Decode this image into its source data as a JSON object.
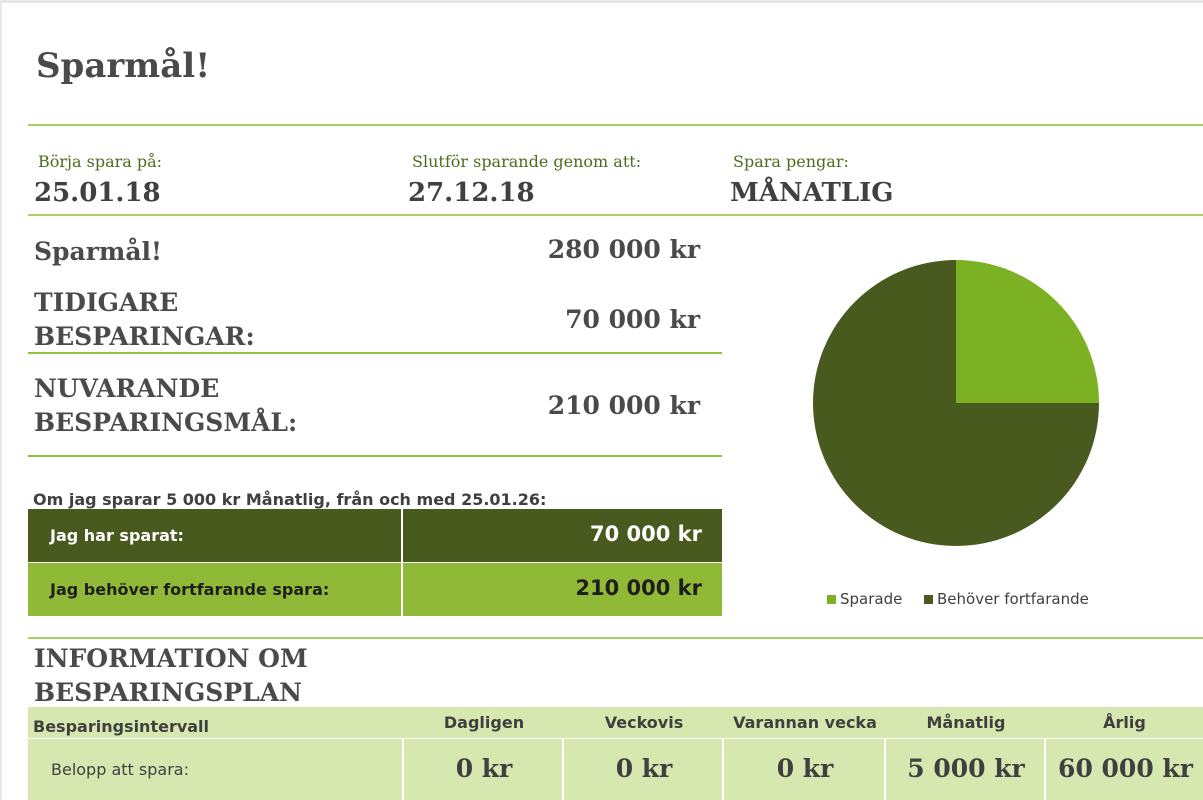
{
  "title": "Sparmål!",
  "start": {
    "label": "Börja spara på:",
    "value": "25.01.18"
  },
  "end": {
    "label": "Slutför sparande genom att:",
    "value": "27.12.18"
  },
  "frequency": {
    "label": "Spara pengar:",
    "value": "MÅNATLIG"
  },
  "goal": {
    "label": "Sparmål!",
    "value": "280 000 kr"
  },
  "previous": {
    "label_line1": "TIDIGARE",
    "label_line2": "BESPARINGAR:",
    "value": "70 000 kr"
  },
  "current_goal": {
    "label_line1": "NUVARANDE",
    "label_line2": "BESPARINGSMÅL:",
    "value": "210 000 kr"
  },
  "sentence": "Om jag sparar 5 000 kr Månatlig, från och med 25.01.26:",
  "saved_row": {
    "label": "Jag har sparat:",
    "value": "70 000 kr"
  },
  "need_row": {
    "label": "Jag behöver fortfarande spara:",
    "value": "210 000 kr"
  },
  "info": {
    "line1": "INFORMATION OM",
    "line2": "BESPARINGSPLAN"
  },
  "plan": {
    "row_header": "Besparingsintervall",
    "row_label": "Belopp att spara:",
    "columns": [
      {
        "name": "Dagligen",
        "value": "0 kr"
      },
      {
        "name": "Veckovis",
        "value": "0 kr"
      },
      {
        "name": "Varannan vecka",
        "value": "0 kr"
      },
      {
        "name": "Månatlig",
        "value": "5 000 kr"
      },
      {
        "name": "Årlig",
        "value": "60 000 kr"
      }
    ]
  },
  "colors": {
    "accent": "#a9cf6a",
    "dark_green": "#485a1e",
    "light_green": "#8fb936",
    "panel": "#d6e8b0"
  },
  "chart_data": {
    "type": "pie",
    "title": "",
    "slices": [
      {
        "name": "Sparade",
        "value": 70000,
        "color": "#7db124"
      },
      {
        "name": "Behöver fortfarande",
        "value": 210000,
        "color": "#485a1e"
      }
    ],
    "legend_position": "bottom"
  }
}
